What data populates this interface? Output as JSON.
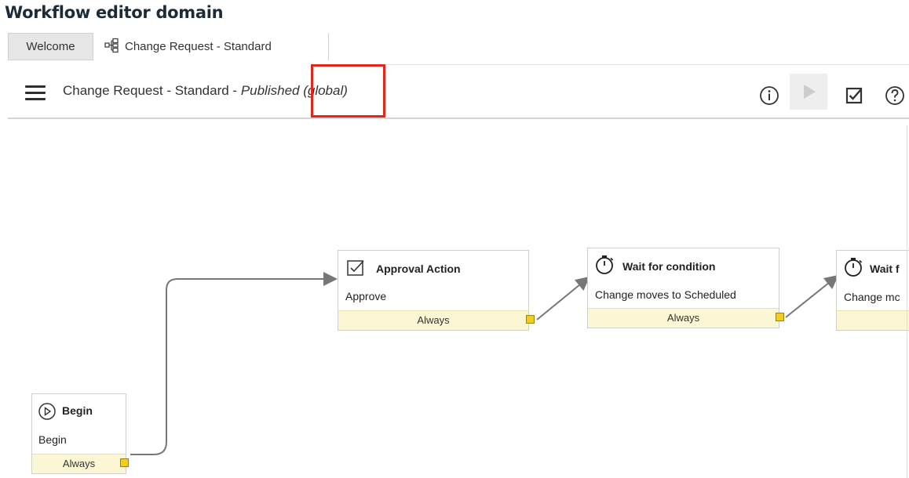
{
  "page_heading": "Workflow editor domain",
  "tabs": {
    "welcome": "Welcome",
    "active": "Change Request - Standard"
  },
  "toolbar": {
    "title_name": "Change Request - Standard",
    "title_sep": " - ",
    "title_state": "Published",
    "title_scope": " (global)",
    "icons": [
      "info-icon",
      "run-icon",
      "validate-icon",
      "help-icon"
    ]
  },
  "activities": {
    "begin": {
      "title": "Begin",
      "desc": "Begin",
      "exit": "Always",
      "icon": "play-circle-icon"
    },
    "approval": {
      "title": "Approval Action",
      "desc": "Approve",
      "exit": "Always",
      "icon": "checkbox-icon"
    },
    "wait1": {
      "title": "Wait for condition",
      "desc": "Change moves to Scheduled",
      "exit": "Always",
      "icon": "stopwatch-icon"
    },
    "wait2": {
      "title": "Wait f",
      "desc": "Change mc",
      "exit": "",
      "icon": "stopwatch-icon"
    }
  },
  "colors": {
    "highlight": "#e2261b",
    "exit_bar": "#fbf6d3",
    "exit_port": "#f2cd1e"
  }
}
